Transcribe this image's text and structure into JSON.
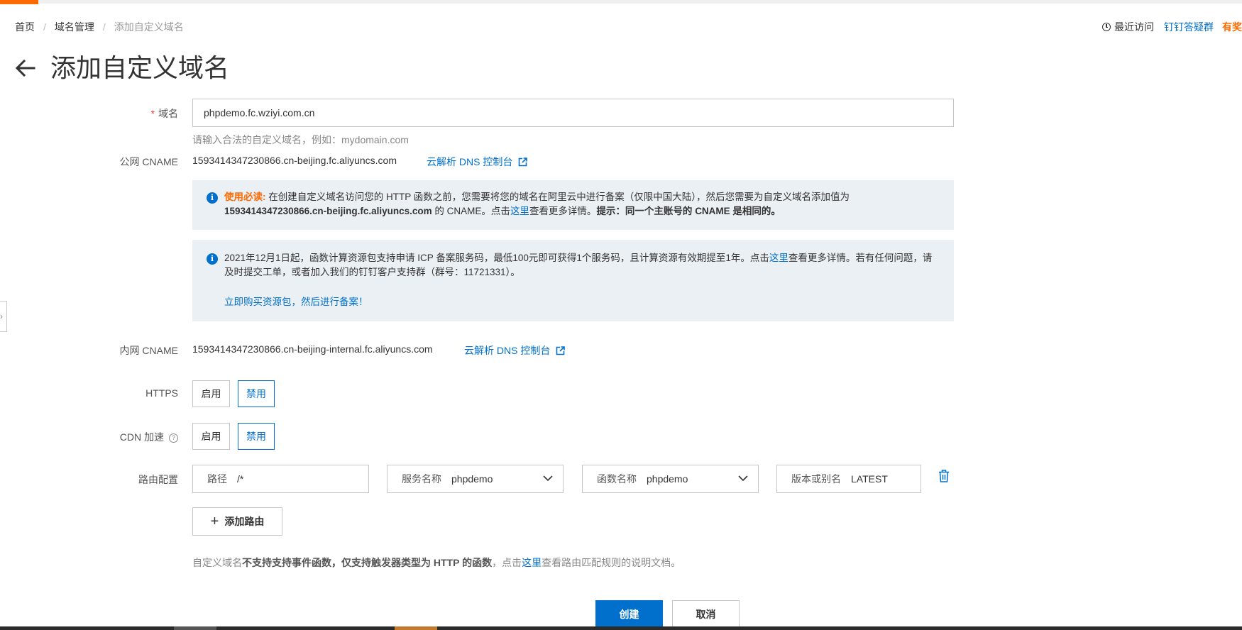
{
  "breadcrumb": {
    "home": "首页",
    "domain_mgmt": "域名管理",
    "current": "添加自定义域名"
  },
  "header_right": {
    "recent": "最近访问",
    "dingtalk": "钉钉答疑群",
    "gift": "有奖"
  },
  "page": {
    "title": "添加自定义域名"
  },
  "form": {
    "domain": {
      "required_mark": "*",
      "label": "域名",
      "value": "phpdemo.fc.wziyi.com.cn",
      "hint": "请输入合法的自定义域名，例如：mydomain.com"
    },
    "public_cname": {
      "label": "公网 CNAME",
      "value": "1593414347230866.cn-beijing.fc.aliyuncs.com",
      "link": "云解析 DNS 控制台"
    },
    "notice1": {
      "lead": "使用必读:",
      "text1": " 在创建自定义域名访问您的 HTTP 函数之前，您需要将您的域名在阿里云中进行备案（仅限中国大陆），然后您需要为自定义域名添加值为",
      "cname_bold": "1593414347230866.cn-beijing.fc.aliyuncs.com",
      "text2": " 的 CNAME。点击",
      "link": "这里",
      "text3": "查看更多详情。",
      "tip_bold": "提示：同一个主账号的 CNAME 是相同的。"
    },
    "notice2": {
      "text1": "2021年12月1日起，函数计算资源包支持申请 ICP 备案服务码，最低100元即可获得1个服务码，且计算资源有效期提至1年。点击",
      "link": "这里",
      "text2": "查看更多详情。若有任何问题，请及时提交工单，或者加入我们的钉钉客户支持群（群号：11721331）。",
      "buy_link": "立即购买资源包，然后进行备案！"
    },
    "internal_cname": {
      "label": "内网 CNAME",
      "value": "1593414347230866.cn-beijing-internal.fc.aliyuncs.com",
      "link": "云解析 DNS 控制台"
    },
    "https": {
      "label": "HTTPS",
      "enable": "启用",
      "disable": "禁用",
      "selected": "禁用"
    },
    "cdn": {
      "label": "CDN 加速",
      "help": "?",
      "enable": "启用",
      "disable": "禁用",
      "selected": "禁用"
    },
    "route": {
      "label": "路由配置",
      "path_key": "路径",
      "path_value": "/*",
      "service_key": "服务名称",
      "service_value": "phpdemo",
      "function_key": "函数名称",
      "function_value": "phpdemo",
      "version_key": "版本或别名",
      "version_value": "LATEST",
      "add_label": "添加路由"
    },
    "footer_note": {
      "t1": "自定义域名",
      "b1": "不支持支持事件函数，仅支持触发器类型为 HTTP 的函数",
      "t2": "，点击",
      "link": "这里",
      "t3": "查看路由匹配规则的说明文档。"
    }
  },
  "actions": {
    "create": "创建",
    "cancel": "取消"
  },
  "colors": {
    "accent": "#0070cc",
    "brand_orange": "#ff6a00",
    "notice_bg": "#ebf0f5"
  }
}
